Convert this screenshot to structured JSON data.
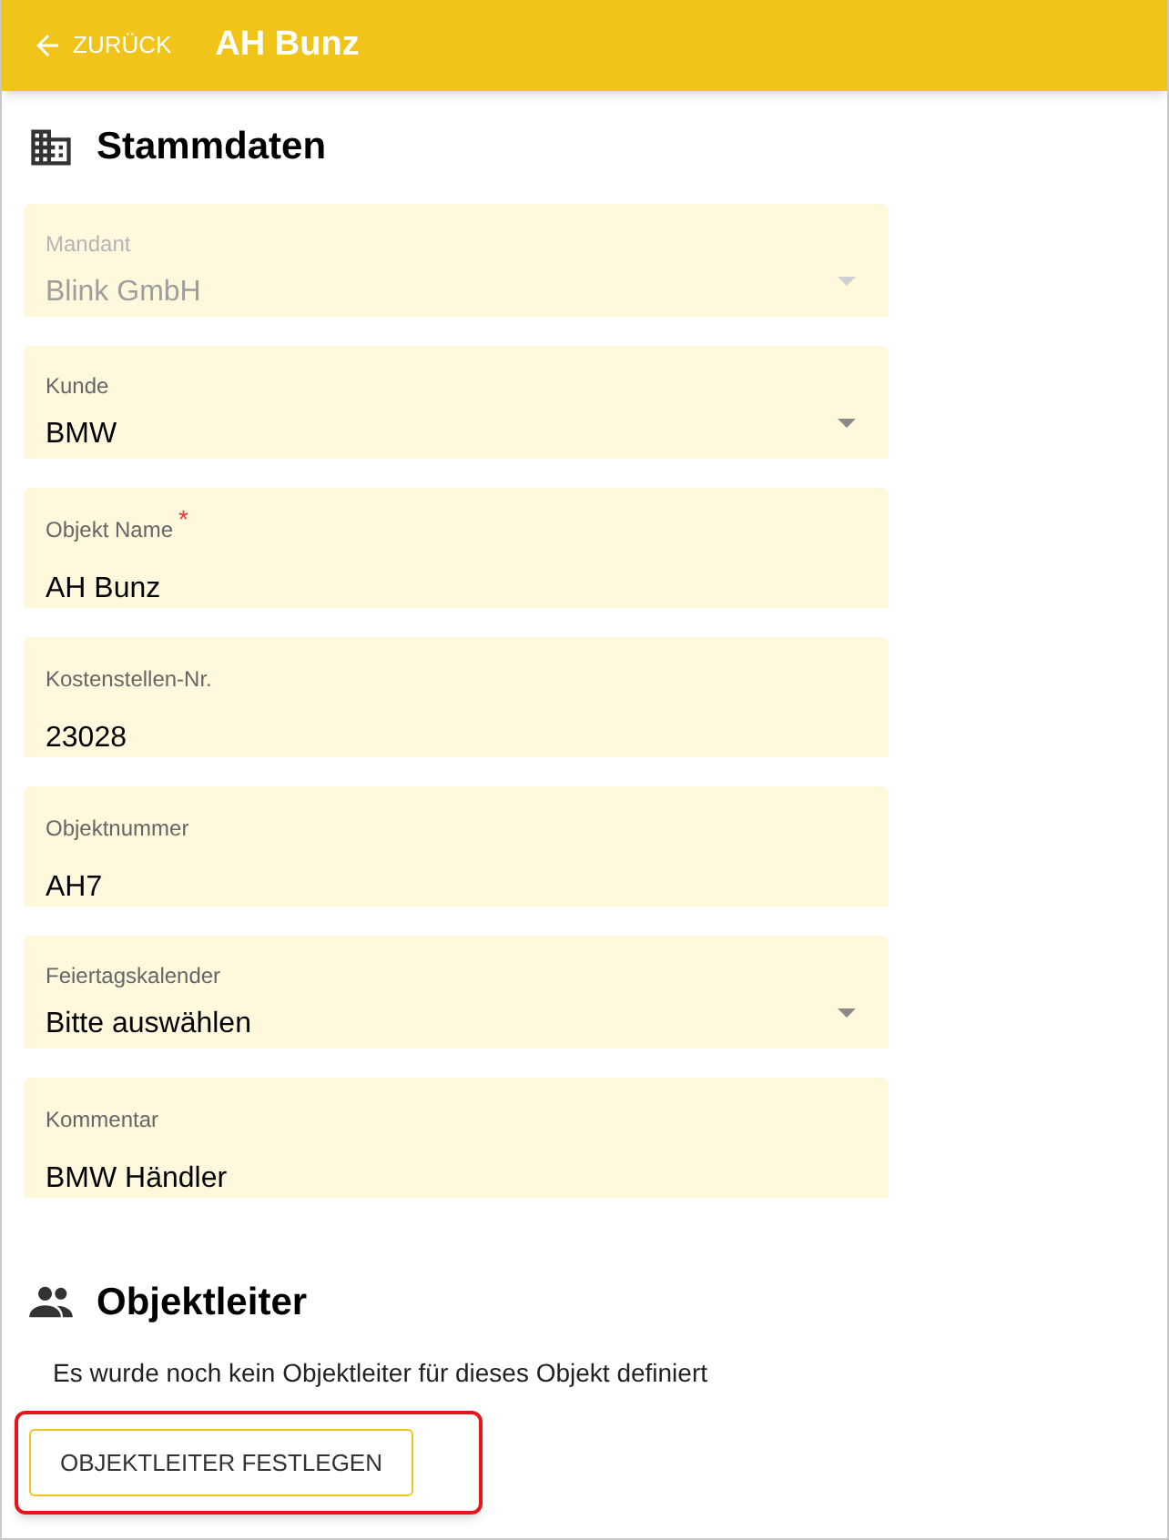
{
  "header": {
    "back_label": "ZURÜCK",
    "title": "AH Bunz"
  },
  "stammdaten": {
    "title": "Stammdaten",
    "fields": [
      {
        "kind": "select",
        "label": "Mandant",
        "value": "Blink GmbH",
        "disabled": true
      },
      {
        "kind": "select",
        "label": "Kunde",
        "value": "BMW",
        "disabled": false
      },
      {
        "kind": "text",
        "label": "Objekt Name",
        "value": "AH Bunz",
        "disabled": false,
        "required_marker": "*"
      },
      {
        "kind": "text",
        "label": "Kostenstellen-Nr.",
        "value": "23028",
        "disabled": false
      },
      {
        "kind": "text",
        "label": "Objektnummer",
        "value": "AH7",
        "disabled": false
      },
      {
        "kind": "select",
        "label": "Feiertagskalender",
        "value": "Bitte auswählen",
        "disabled": false
      },
      {
        "kind": "text",
        "label": "Kommentar",
        "value": "BMW Händler",
        "disabled": false
      }
    ]
  },
  "objektleiter": {
    "title": "Objektleiter",
    "message": "Es wurde noch kein Objektleiter für dieses Objekt definiert",
    "button": {
      "label": "OBJEKTLEITER FESTLEGEN",
      "highlighted": true
    }
  }
}
